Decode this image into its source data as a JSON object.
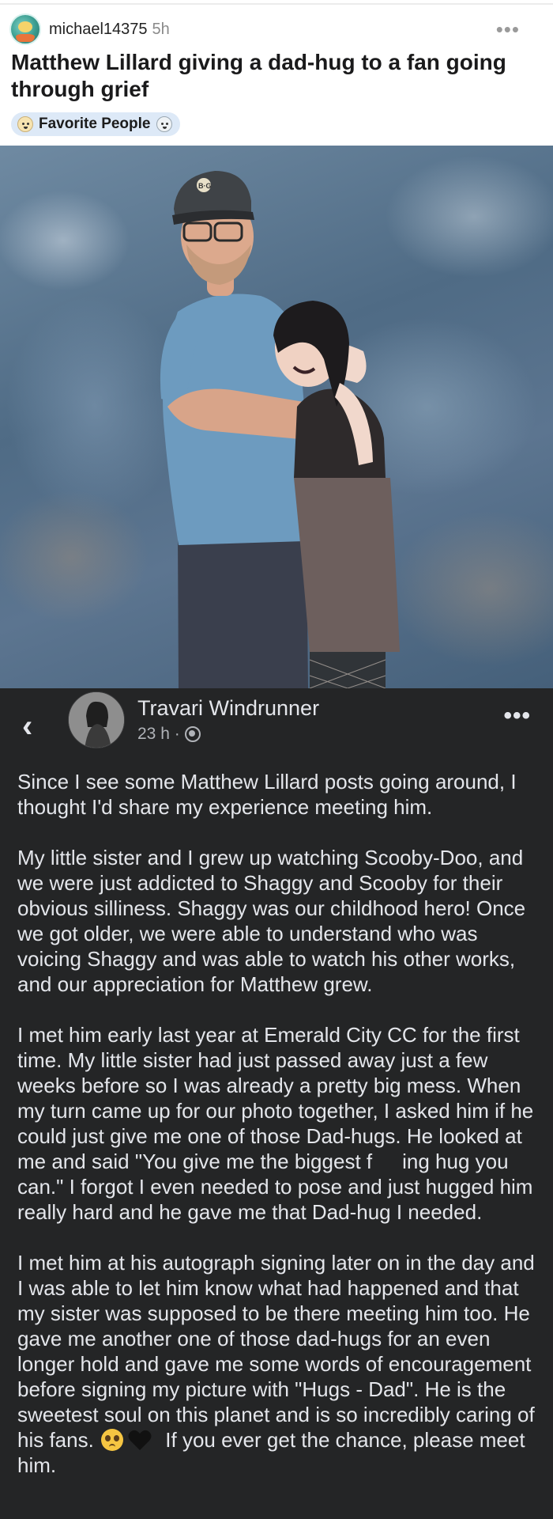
{
  "post": {
    "username": "michael14375",
    "time": "5h",
    "more": "•••",
    "title": "Matthew Lillard giving a dad-hug to a fan going through grief",
    "flair": "Favorite People",
    "image_alt": "Man in a cap and blue t-shirt hugging a young woman in front of a mottled blue backdrop",
    "cap_logo": "B·G"
  },
  "fb_post": {
    "back": "‹",
    "author": "Travari Windrunner",
    "time": "23 h ·",
    "more": "•••",
    "paragraphs": [
      "Since I see some Matthew Lillard posts going around, I thought I'd share my experience meeting him.",
      "My little sister and I grew up watching Scooby-Doo, and we were just addicted to Shaggy and Scooby for their obvious silliness. Shaggy was our childhood hero! Once we got older, we were able to understand who was voicing Shaggy and was able to watch his other works, and our appreciation for Matthew grew."
    ],
    "p3_before": "I met him early last year at Emerald City CC for the first time. My little sister had just passed away just a few weeks before so I was already a pretty big mess. When my turn came up for our photo together, I asked him if he could just give me one of those Dad-hugs. He looked at me and said \"You give me the biggest f",
    "p3_after": "ing hug you can.\" I forgot I even needed to pose and just hugged him really hard and he gave me that Dad-hug I needed.",
    "p4_before": "I met him at his autograph signing later on in the day and I was able to let him know what had happened and that my sister was supposed to be there meeting him too. He gave me another one of those dad-hugs for an even longer hold and gave me some words of encouragement before signing my picture with \"Hugs - Dad\". He is the sweetest soul on this planet and is so incredibly caring of his fans.",
    "p4_after": " If you ever get the chance, please meet him."
  },
  "colors": {
    "fb_background": "#242526",
    "fb_text": "#e4e6eb",
    "flair_background": "#dde9f7"
  }
}
